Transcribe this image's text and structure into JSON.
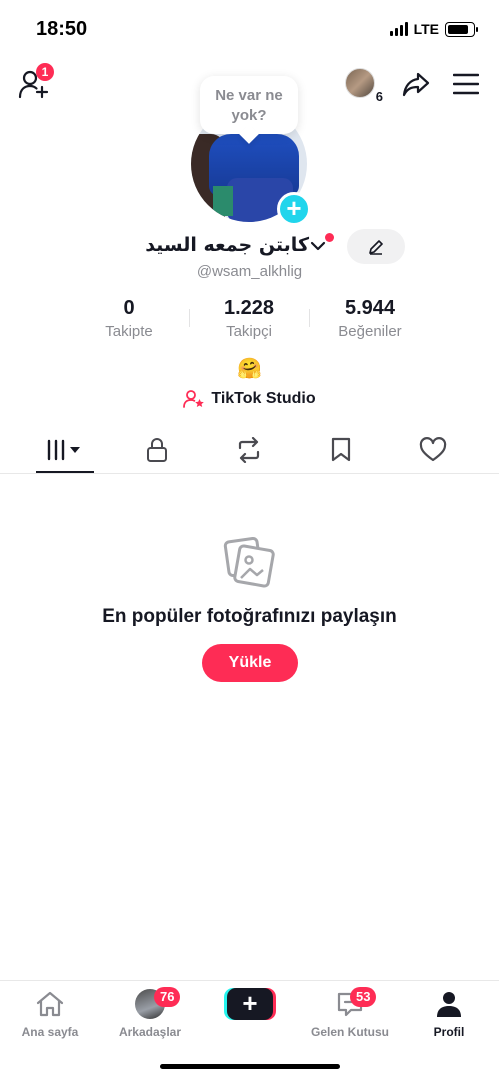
{
  "status": {
    "time": "18:50",
    "network": "LTE",
    "battery_level": 0.85
  },
  "header": {
    "friend_badge": "1",
    "story_count": "6"
  },
  "bubble": {
    "text": "Ne var ne yok?"
  },
  "profile": {
    "display_name": "كابتن جمعه السيد",
    "username": "@wsam_alkhlig",
    "bio_emoji": "🤗",
    "studio_label": "TikTok Studio"
  },
  "stats": [
    {
      "value": "0",
      "label": "Takipte"
    },
    {
      "value": "1.228",
      "label": "Takipçi"
    },
    {
      "value": "5.944",
      "label": "Beğeniler"
    }
  ],
  "tabs": [
    {
      "icon": "grid-icon",
      "active": true
    },
    {
      "icon": "lock-icon",
      "active": false
    },
    {
      "icon": "repost-icon",
      "active": false
    },
    {
      "icon": "bookmark-icon",
      "active": false
    },
    {
      "icon": "heart-icon",
      "active": false
    }
  ],
  "empty_state": {
    "title": "En popüler fotoğrafınızı paylaşın",
    "button": "Yükle"
  },
  "nav": {
    "home": "Ana sayfa",
    "friends": "Arkadaşlar",
    "friends_badge": "76",
    "inbox": "Gelen Kutusu",
    "inbox_badge": "53",
    "profile": "Profil"
  },
  "colors": {
    "accent": "#fe2c55",
    "cyan": "#20d5ec",
    "text": "#161823",
    "muted": "#8a8b91"
  }
}
